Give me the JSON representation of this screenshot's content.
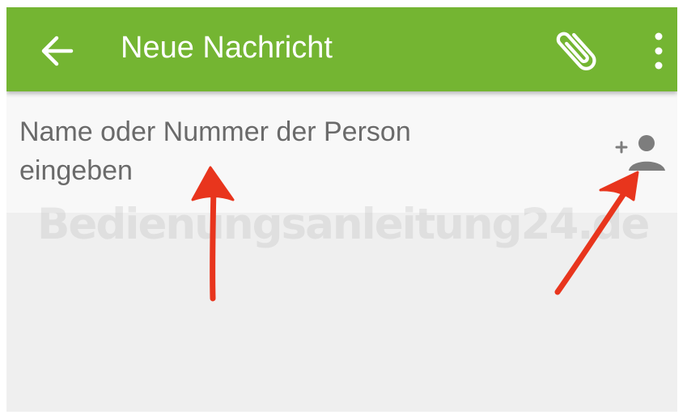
{
  "toolbar": {
    "title": "Neue Nachricht",
    "back_icon": "arrow-left-icon",
    "attach_icon": "paperclip-icon",
    "more_icon": "more-vertical-icon",
    "background_color": "#74b532",
    "text_color": "#ffffff"
  },
  "compose": {
    "recipient_placeholder": "Name oder Nummer der Person\neingeben",
    "add_contact_icon": "add-person-icon"
  },
  "watermark": {
    "text": "Bedienungsanleitung24.de"
  },
  "annotations": {
    "arrow_color": "#e8351d",
    "arrow_count": 2
  }
}
